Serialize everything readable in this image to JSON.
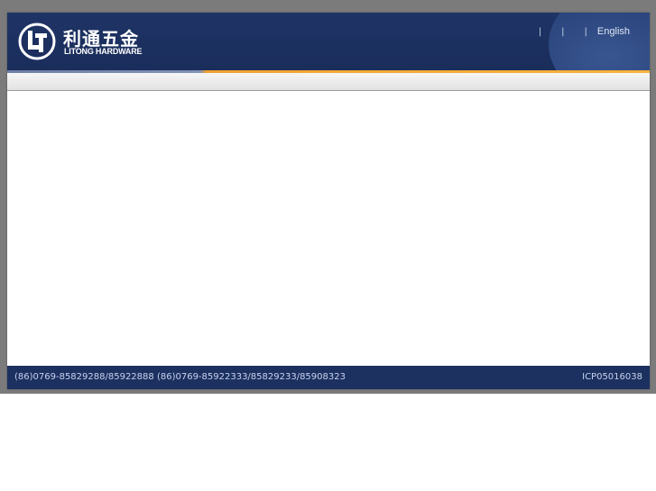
{
  "header": {
    "brand_cn": "利通五金",
    "brand_en": "LITONG HARDWARE",
    "toplinks": [
      "",
      "",
      "",
      "English"
    ],
    "nav_items": [
      "",
      "",
      "",
      "",
      "",
      "",
      ""
    ]
  },
  "subbar": {
    "text": ""
  },
  "footer": {
    "company": "",
    "phone_label": "",
    "phone": "(86)0769-85829288/85922888",
    "fax_label": "",
    "fax": "(86)0769-85922333/85829233/85908323",
    "icp": "ICP05016038"
  },
  "colors": {
    "header_navy": "#1f3466",
    "accent_orange": "#f7b23c",
    "footer_navy": "#1c3160",
    "backdrop_gray": "#7b7b7b"
  }
}
